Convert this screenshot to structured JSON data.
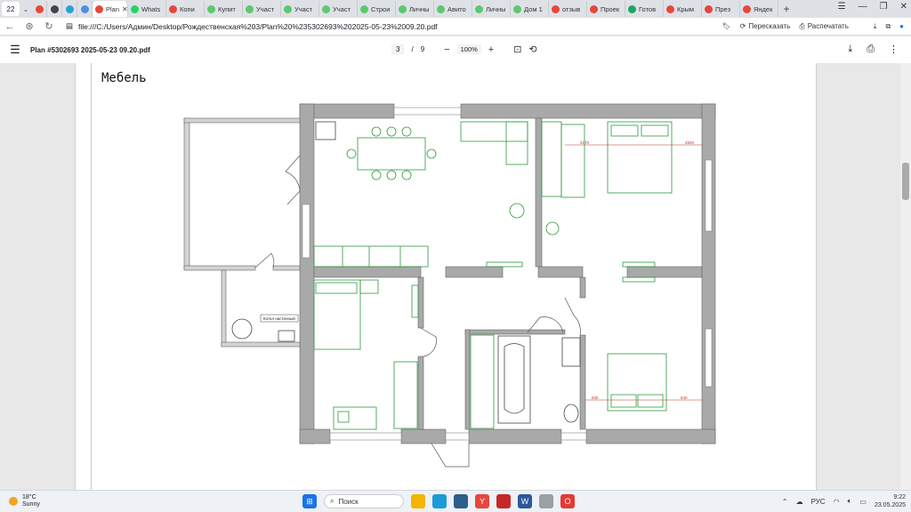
{
  "tabs": {
    "count": "22",
    "items": [
      {
        "label": "",
        "color": "#e8453c",
        "kind": "small"
      },
      {
        "label": "",
        "color": "#444444",
        "kind": "small"
      },
      {
        "label": "",
        "color": "#2a9fd8",
        "kind": "small"
      },
      {
        "label": "",
        "color": "#4a90e2",
        "kind": "small"
      },
      {
        "label": "Plan",
        "color": "#e8453c",
        "kind": "active"
      },
      {
        "label": "Whats",
        "color": "#25d366",
        "kind": "tab"
      },
      {
        "label": "Копи",
        "color": "#e8453c",
        "kind": "tab"
      },
      {
        "label": "Купит",
        "color": "#5cc86f",
        "kind": "tab"
      },
      {
        "label": "Участ",
        "color": "#5cc86f",
        "kind": "tab"
      },
      {
        "label": "Участ",
        "color": "#5cc86f",
        "kind": "tab"
      },
      {
        "label": "Участ",
        "color": "#5cc86f",
        "kind": "tab"
      },
      {
        "label": "Строи",
        "color": "#5cc86f",
        "kind": "tab"
      },
      {
        "label": "Личны",
        "color": "#5cc86f",
        "kind": "tab"
      },
      {
        "label": "Авито",
        "color": "#5cc86f",
        "kind": "tab"
      },
      {
        "label": "Личны",
        "color": "#5cc86f",
        "kind": "tab"
      },
      {
        "label": "Дом 1",
        "color": "#5cc86f",
        "kind": "tab"
      },
      {
        "label": "отзыв",
        "color": "#e8453c",
        "kind": "tab"
      },
      {
        "label": "Проек",
        "color": "#e8453c",
        "kind": "tab"
      },
      {
        "label": "Готов",
        "color": "#1fa463",
        "kind": "tab"
      },
      {
        "label": "Крым",
        "color": "#e8453c",
        "kind": "tab"
      },
      {
        "label": "През",
        "color": "#e8453c",
        "kind": "tab"
      },
      {
        "label": "Яндек",
        "color": "#e8453c",
        "kind": "tab"
      }
    ]
  },
  "address": {
    "url": "file:///C:/Users/Админ/Desktop/Рождественская%203/Plan%20%235302693%202025-05-23%2009.20.pdf",
    "retell": "Пересказать",
    "print": "Распечатать"
  },
  "pdf": {
    "title": "Plan #5302693 2025-05-23 09.20.pdf",
    "page_current": "3",
    "page_sep": "/",
    "page_total": "9",
    "zoom": "100%"
  },
  "document": {
    "heading": "Мебель",
    "boiler_label": "Котел настенный",
    "dimensions": [
      "4170",
      "2500",
      "830",
      "840"
    ]
  },
  "taskbar": {
    "temperature": "18°C",
    "weather": "Sunny",
    "search": "Поиск",
    "language": "РУС",
    "time": "9:22",
    "date": "23.05.2025"
  },
  "colors": {
    "wall": "#999999",
    "furniture": "#2e9a3e",
    "accent": "#1a73e8"
  }
}
